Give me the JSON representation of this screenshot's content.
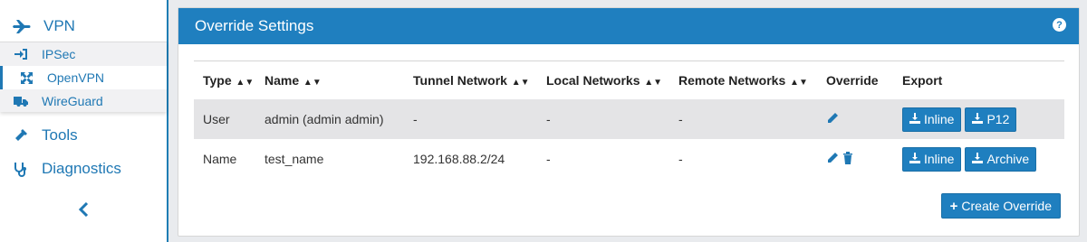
{
  "sidebar": {
    "vpn_label": "VPN",
    "submenu": [
      {
        "label": "IPSec",
        "icon": "sign-in-icon"
      },
      {
        "label": "OpenVPN",
        "icon": "arrows-icon"
      },
      {
        "label": "WireGuard",
        "icon": "truck-icon"
      }
    ],
    "tools_label": "Tools",
    "diagnostics_label": "Diagnostics",
    "collapse_glyph": "‹"
  },
  "panel": {
    "title": "Override Settings",
    "help_glyph": "?"
  },
  "table": {
    "headers": {
      "type": "Type",
      "name": "Name",
      "tunnel": "Tunnel Network",
      "local": "Local Networks",
      "remote": "Remote Networks",
      "override": "Override",
      "export": "Export"
    },
    "rows": [
      {
        "type": "User",
        "name": "admin (admin admin)",
        "tunnel": "-",
        "local": "-",
        "remote": "-",
        "btn1": "Inline",
        "btn2": "P12"
      },
      {
        "type": "Name",
        "name": "test_name",
        "tunnel": "192.168.88.2/24",
        "local": "-",
        "remote": "-",
        "btn1": "Inline",
        "btn2": "Archive"
      }
    ]
  },
  "create_button": "Create Override",
  "colors": {
    "accent": "#1f7fbf",
    "row_highlight": "#e4e4e6"
  }
}
